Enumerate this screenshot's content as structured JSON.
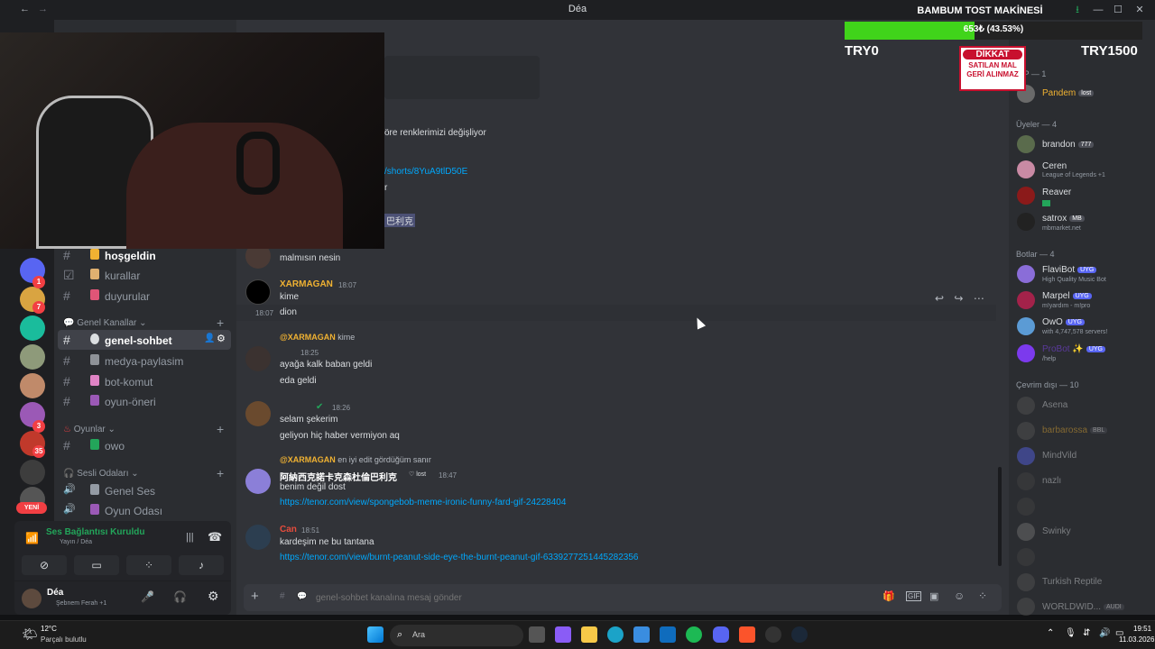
{
  "window": {
    "title": "Déa"
  },
  "colors": {
    "accent": "#5865f2",
    "green": "#23a55a",
    "red": "#f23f43",
    "link": "#00a8fc",
    "progress_green": "#40d41a"
  },
  "sidebar": {
    "channels_top": [
      {
        "label": "hoşgeldin",
        "icon": "wave-icon"
      },
      {
        "label": "kurallar",
        "icon": "scroll-icon"
      },
      {
        "label": "duyurular",
        "icon": "megaphone-icon"
      }
    ],
    "cat_general": "Genel Kanallar",
    "general_channels": [
      {
        "label": "genel-sohbet",
        "active": true
      },
      {
        "label": "medya-paylasim"
      },
      {
        "label": "bot-komut"
      },
      {
        "label": "oyun-öneri"
      }
    ],
    "cat_games": "Oyunlar",
    "games_channels": [
      {
        "label": "owo"
      }
    ],
    "cat_voice": "Sesli Odaları",
    "voice_channels": [
      {
        "label": "Genel Ses"
      },
      {
        "label": "Oyun Odası"
      }
    ],
    "new_badge": "YENİ"
  },
  "server_badges": [
    "1",
    "7",
    "3",
    "35"
  ],
  "voice_panel": {
    "status": "Ses Bağlantısı Kuruldu",
    "channel": "Yayın / Déa"
  },
  "user_panel": {
    "name": "Déa",
    "status": "Şebnem Ferah +1"
  },
  "chat": {
    "partial_lines": [
      "öre renklerimizi değişliyor",
      "/shorts/8YuA9tlD50E",
      "r",
      "巴利克"
    ],
    "messages": [
      {
        "text": "malmısın nesin"
      },
      {
        "author": "XARMAGAN",
        "time": "18:07",
        "lines": [
          "kime",
          "dion"
        ],
        "hover_time": "18:07"
      },
      {
        "reply_to": "@XARMAGAN",
        "reply_text": "kime",
        "author": "",
        "time": "18:25",
        "lines": [
          "ayağa kalk baban geldi",
          "eda geldi"
        ]
      },
      {
        "author": "",
        "time": "18:26",
        "lines": [
          "selam şekerim",
          "geliyon hiç haber vermiyon aq"
        ]
      },
      {
        "reply_to": "@XARMAGAN",
        "reply_text": "en iyi edit gördüğüm sanır",
        "author": "阿納西克諾卡克森杜倫巴利克",
        "author_tag": "lost",
        "time": "18:47",
        "lines": [
          "benim değil dost"
        ],
        "link": "https://tenor.com/view/spongebob-meme-ironic-funny-fard-gif-24228404"
      },
      {
        "author": "Can",
        "time": "18:51",
        "lines": [
          "kardeşim ne bu tantana"
        ],
        "link": "https://tenor.com/view/burnt-peanut-side-eye-the-burnt-peanut-gif-6339277251445282356"
      }
    ],
    "input_placeholder": "genel-sohbet kanalına mesaj gönder"
  },
  "members": {
    "vip_head": "VIP — 1",
    "vip": [
      {
        "name": "Pandem",
        "tag": "lost"
      }
    ],
    "users_head": "Üyeler — 4",
    "users": [
      {
        "name": "brandon",
        "tag": "777"
      },
      {
        "name": "Ceren",
        "sub": "League of Legends +1"
      },
      {
        "name": "Reaver"
      },
      {
        "name": "satrox",
        "tag": "MB",
        "sub": "mbmarket.net"
      }
    ],
    "bots_head": "Botlar — 4",
    "bots": [
      {
        "name": "FlaviBot",
        "tag": "UYG",
        "sub": "High Quality Music Bot"
      },
      {
        "name": "Marpel",
        "tag": "UYG",
        "sub": "m!yardım - m!pro"
      },
      {
        "name": "OwO",
        "tag": "UYG",
        "sub": "with 4,747,578 servers!"
      },
      {
        "name": "ProBot ✨",
        "tag": "UYG",
        "sub": "/help"
      }
    ],
    "offline_head": "Çevrim dışı — 10",
    "offline": [
      {
        "name": "Asena"
      },
      {
        "name": "barbarossa",
        "tag": "BBL"
      },
      {
        "name": "MindVild"
      },
      {
        "name": "nazlı"
      },
      {
        "name": ""
      },
      {
        "name": "Swinky"
      },
      {
        "name": ""
      },
      {
        "name": "Turkish Reptile"
      },
      {
        "name": "WORLDWID...",
        "tag": "AUDI"
      }
    ]
  },
  "overlay": {
    "title": "BAMBUM TOST MAKİNESİ",
    "progress_text": "653₺ (43.53%)",
    "progress_fraction": 0.4353,
    "left_label": "TRY0",
    "right_label": "TRY1500",
    "warning_title": "DİKKAT",
    "warning_text": "SATILAN MAL GERİ ALINMAZ"
  },
  "taskbar": {
    "weather_temp": "12°C",
    "weather_desc": "Parçalı bulutlu",
    "search": "Ara",
    "time": "19:51",
    "date": "11.03.2026"
  }
}
